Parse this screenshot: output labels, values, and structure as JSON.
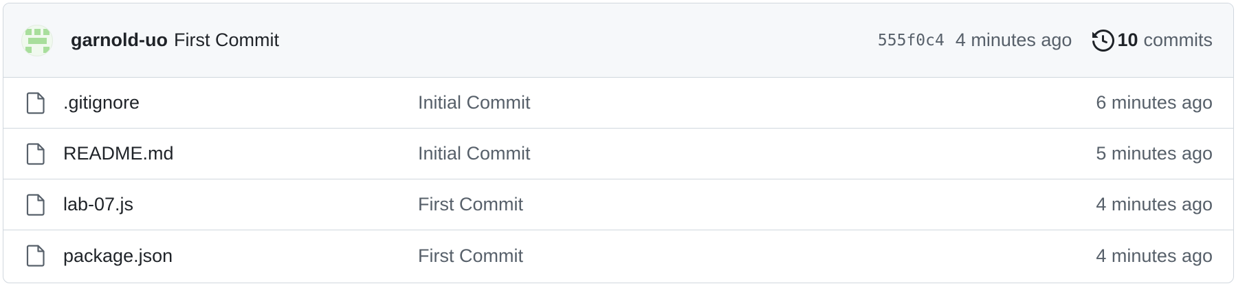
{
  "latest_commit": {
    "author": "garnold-uo",
    "message": "First Commit",
    "sha": "555f0c4",
    "age": "4 minutes ago",
    "commits_count": "10",
    "commits_label": "commits",
    "avatar_color": "#a8de9c",
    "history_icon": "history-icon"
  },
  "files": [
    {
      "name": ".gitignore",
      "commit_message": "Initial Commit",
      "age": "6 minutes ago",
      "icon": "file-icon"
    },
    {
      "name": "README.md",
      "commit_message": "Initial Commit",
      "age": "5 minutes ago",
      "icon": "file-icon"
    },
    {
      "name": "lab-07.js",
      "commit_message": "First Commit",
      "age": "4 minutes ago",
      "icon": "file-icon"
    },
    {
      "name": "package.json",
      "commit_message": "First Commit",
      "age": "4 minutes ago",
      "icon": "file-icon"
    }
  ],
  "colors": {
    "border": "#d0d7de",
    "header_bg": "#f6f8fa",
    "text_primary": "#1f2328",
    "text_muted": "#57606a"
  }
}
